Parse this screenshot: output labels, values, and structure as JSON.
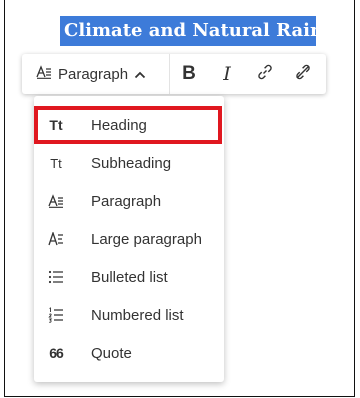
{
  "document": {
    "selected_heading_text": "Climate and Natural Rainfall"
  },
  "toolbar": {
    "style_selector_label": "Paragraph",
    "bold_label": "B",
    "italic_label": "I"
  },
  "dropdown": {
    "items": [
      {
        "label": "Heading",
        "icon": "Tt"
      },
      {
        "label": "Subheading",
        "icon": "Tt"
      },
      {
        "label": "Paragraph",
        "icon": "paragraph-icon"
      },
      {
        "label": "Large paragraph",
        "icon": "large-paragraph-icon"
      },
      {
        "label": "Bulleted list",
        "icon": "bulleted-list-icon"
      },
      {
        "label": "Numbered list",
        "icon": "numbered-list-icon"
      },
      {
        "label": "Quote",
        "icon": "66"
      }
    ],
    "highlighted_index": 0,
    "highlight_color": "#e0171f"
  },
  "colors": {
    "selection": "#3d7bd9",
    "text": "#333333"
  }
}
